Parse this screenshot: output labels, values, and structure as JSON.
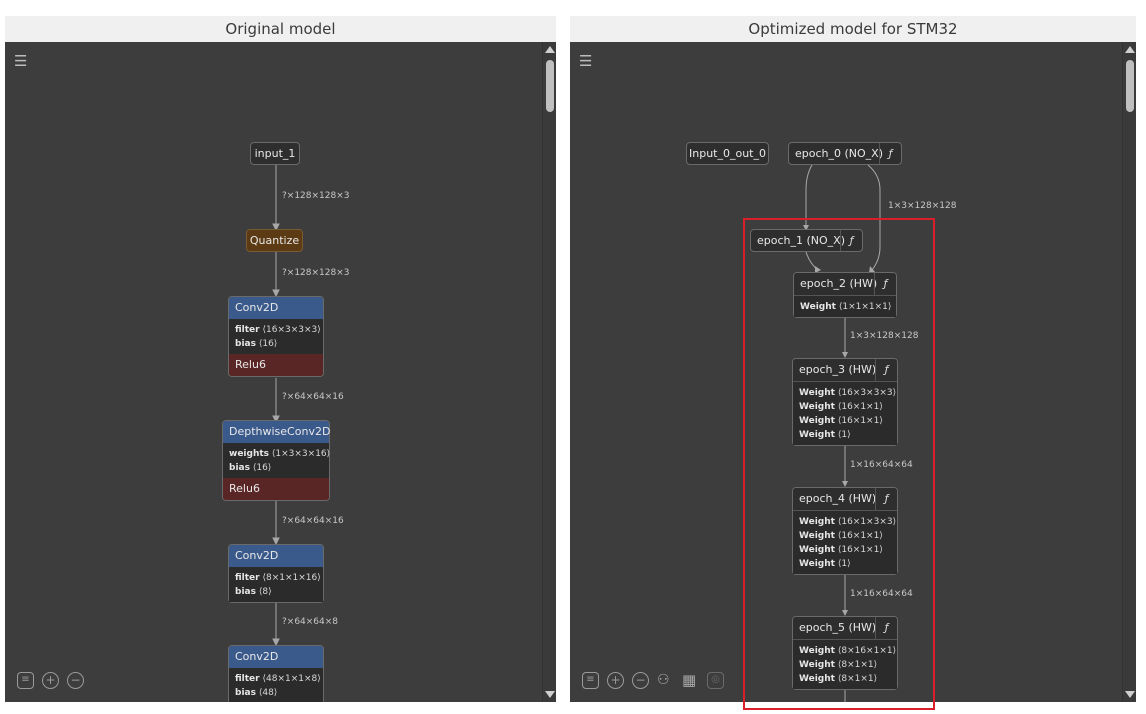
{
  "titles": {
    "left": "Original model",
    "right": "Optimized model for STM32"
  },
  "icons": {
    "menu": "☰",
    "list": "≡",
    "zoom_in": "+",
    "zoom_out": "−",
    "fn": "ƒ",
    "tree": "⚇",
    "grid": "▦",
    "lock": "◎"
  },
  "left_graph": {
    "nodes": [
      {
        "title": "input_1"
      },
      {
        "title": "Quantize"
      },
      {
        "title": "Conv2D",
        "params": [
          {
            "k": "filter",
            "v": "⟨16×3×3×3⟩"
          },
          {
            "k": "bias",
            "v": "⟨16⟩"
          }
        ],
        "activation": "Relu6"
      },
      {
        "title": "DepthwiseConv2D",
        "params": [
          {
            "k": "weights",
            "v": "⟨1×3×3×16⟩"
          },
          {
            "k": "bias",
            "v": "⟨16⟩"
          }
        ],
        "activation": "Relu6"
      },
      {
        "title": "Conv2D",
        "params": [
          {
            "k": "filter",
            "v": "⟨8×1×1×16⟩"
          },
          {
            "k": "bias",
            "v": "⟨8⟩"
          }
        ]
      },
      {
        "title": "Conv2D",
        "params": [
          {
            "k": "filter",
            "v": "⟨48×1×1×8⟩"
          },
          {
            "k": "bias",
            "v": "⟨48⟩"
          }
        ]
      }
    ],
    "edges": [
      "?×128×128×3",
      "?×128×128×3",
      "?×64×64×16",
      "?×64×64×16",
      "?×64×64×8"
    ]
  },
  "right_graph": {
    "nodes": [
      {
        "title": "Input_0_out_0"
      },
      {
        "title": "epoch_0 (NO_X)"
      },
      {
        "title": "epoch_1 (NO_X)"
      },
      {
        "title": "epoch_2 (HW)",
        "params": [
          {
            "k": "Weight",
            "v": "⟨1×1×1×1⟩"
          }
        ]
      },
      {
        "title": "epoch_3 (HW)",
        "params": [
          {
            "k": "Weight",
            "v": "⟨16×3×3×3⟩"
          },
          {
            "k": "Weight",
            "v": "⟨16×1×1⟩"
          },
          {
            "k": "Weight",
            "v": "⟨16×1×1⟩"
          },
          {
            "k": "Weight",
            "v": "⟨1⟩"
          }
        ]
      },
      {
        "title": "epoch_4 (HW)",
        "params": [
          {
            "k": "Weight",
            "v": "⟨16×1×3×3⟩"
          },
          {
            "k": "Weight",
            "v": "⟨16×1×1⟩"
          },
          {
            "k": "Weight",
            "v": "⟨16×1×1⟩"
          },
          {
            "k": "Weight",
            "v": "⟨1⟩"
          }
        ]
      },
      {
        "title": "epoch_5 (HW)",
        "params": [
          {
            "k": "Weight",
            "v": "⟨8×16×1×1⟩"
          },
          {
            "k": "Weight",
            "v": "⟨8×1×1⟩"
          },
          {
            "k": "Weight",
            "v": "⟨8×1×1⟩"
          }
        ]
      }
    ],
    "edges": [
      "1×3×128×128",
      "1×3×128×128",
      "1×16×64×64",
      "1×16×64×64"
    ]
  },
  "colors": {
    "highlight": "#d9202a",
    "conv_header": "#3b5a8c",
    "activation": "#5a2525",
    "quantize": "#5c3b14"
  }
}
